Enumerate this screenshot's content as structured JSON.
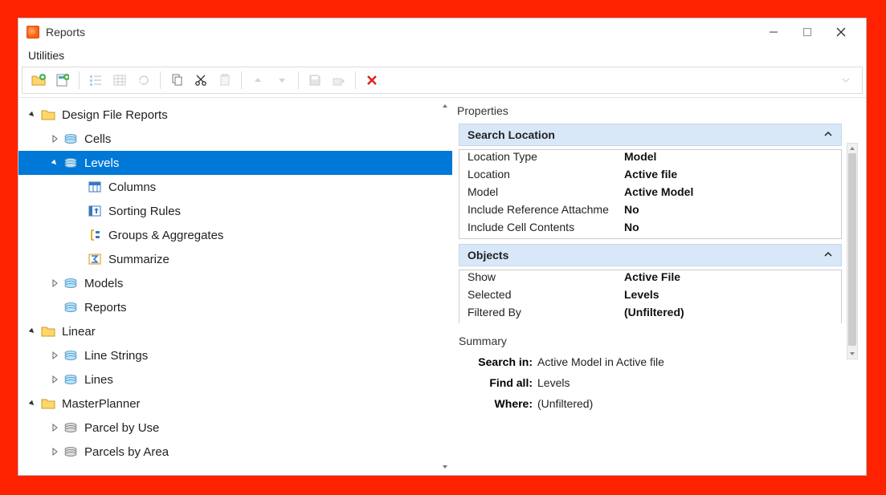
{
  "window": {
    "title": "Reports"
  },
  "menu": {
    "utilities": "Utilities"
  },
  "tree": {
    "design_file_reports": "Design File Reports",
    "cells": "Cells",
    "levels": "Levels",
    "columns": "Columns",
    "sorting_rules": "Sorting Rules",
    "groups_aggregates": "Groups & Aggregates",
    "summarize": "Summarize",
    "models": "Models",
    "reports": "Reports",
    "linear": "Linear",
    "line_strings": "Line Strings",
    "lines": "Lines",
    "masterplanner": "MasterPlanner",
    "parcel_by_use": "Parcel by Use",
    "parcels_by_area": "Parcels by Area"
  },
  "properties": {
    "title": "Properties",
    "search_location": {
      "header": "Search Location",
      "location_type": {
        "k": "Location Type",
        "v": "Model"
      },
      "location": {
        "k": "Location",
        "v": "Active file"
      },
      "model": {
        "k": "Model",
        "v": "Active Model"
      },
      "include_ref": {
        "k": "Include Reference Attachme",
        "v": "No"
      },
      "include_cell": {
        "k": "Include Cell Contents",
        "v": "No"
      }
    },
    "objects": {
      "header": "Objects",
      "show": {
        "k": "Show",
        "v": "Active File"
      },
      "selected": {
        "k": "Selected",
        "v": "Levels"
      },
      "filtered_by": {
        "k": "Filtered By",
        "v": "(Unfiltered)"
      }
    }
  },
  "summary": {
    "title": "Summary",
    "search_in": {
      "k": "Search in:",
      "v": "Active Model  in Active file"
    },
    "find_all": {
      "k": "Find all:",
      "v": "Levels"
    },
    "where": {
      "k": "Where:",
      "v": "(Unfiltered)"
    }
  }
}
